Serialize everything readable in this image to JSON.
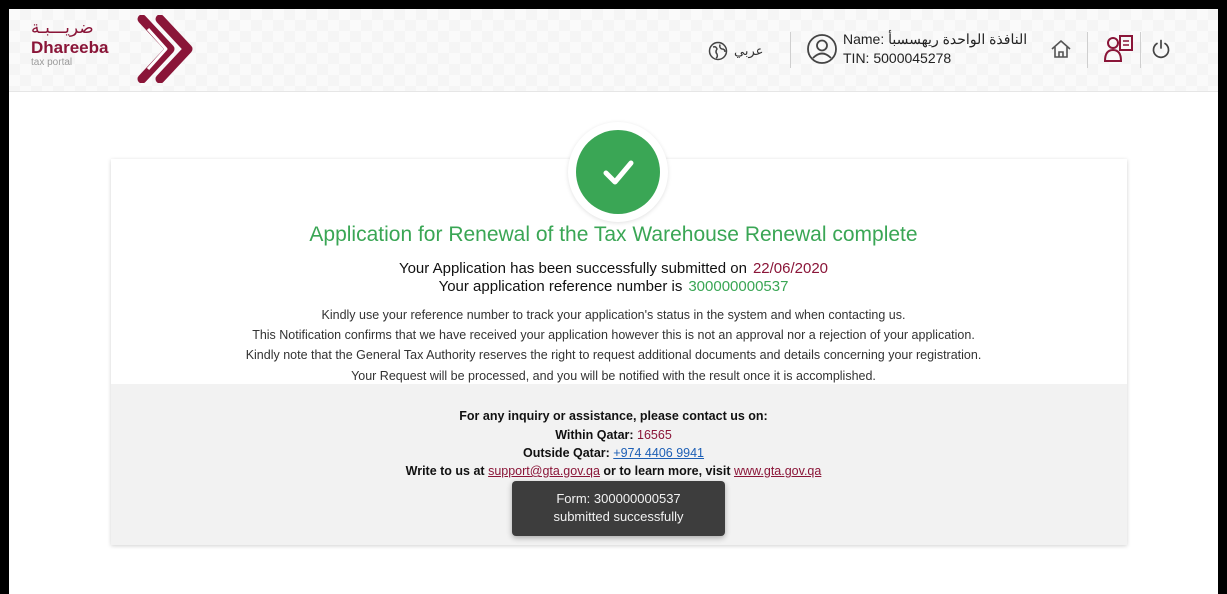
{
  "header": {
    "logo_arabic": "ضريـــبـة",
    "logo_name": "Dhareeba",
    "logo_sub": "tax portal",
    "language_label": "عربي",
    "user_name": "Name: النافذة الواحدة ريهسسبأ",
    "user_tin": "TIN: 5000045278"
  },
  "confirmation": {
    "title": "Application for Renewal of the Tax Warehouse Renewal complete",
    "submitted_label": "Your Application has been successfully submitted on",
    "submitted_date": "22/06/2020",
    "reference_label": "Your application reference number is",
    "reference_number": "300000000537",
    "notes": [
      "Kindly use your reference number to track your application's status in the system and when contacting us.",
      "This Notification confirms that we have received your application however this is not an approval nor a rejection of your application.",
      "Kindly note that the General Tax Authority reserves the right to request additional documents and details concerning your registration.",
      "Your Request will be processed, and you will be notified with the result once it is accomplished."
    ]
  },
  "contact": {
    "heading": "For any inquiry or assistance, please contact us on:",
    "within_label": "Within Qatar:",
    "within_number": "16565",
    "outside_label": "Outside Qatar:",
    "outside_number": "+974 4406 9941",
    "write_label": "Write to us at",
    "email": "support@gta.gov.qa",
    "learn_more_label": "or to learn more, visit",
    "website": "www.gta.gov.qa"
  },
  "toast": {
    "line1": "Form: 300000000537",
    "line2": "submitted successfully"
  },
  "colors": {
    "brand": "#8a1538",
    "success": "#3aa655",
    "link": "#1d5fb5"
  }
}
